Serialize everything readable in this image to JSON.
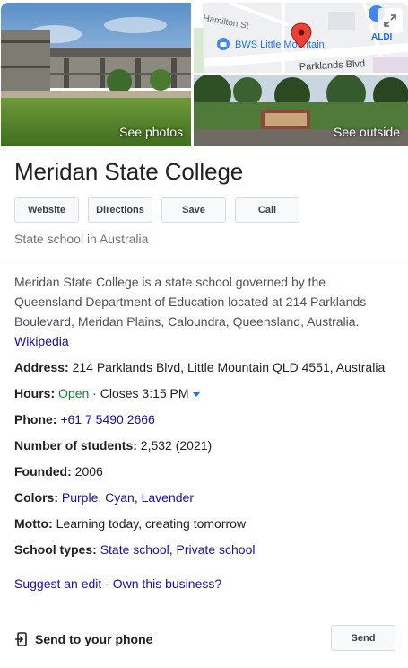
{
  "photos": {
    "left_label": "See photos",
    "right_label": "See outside",
    "map": {
      "street_top": "Hamilton St",
      "poi_label": "BWS Little Mountain",
      "street_main": "Parklands Blvd",
      "store_label": "ALDI"
    }
  },
  "title": "Meridan State College",
  "actions": {
    "website": "Website",
    "directions": "Directions",
    "save": "Save",
    "call": "Call"
  },
  "subtitle": "State school in Australia",
  "description": {
    "text": "Meridan State College is a state school governed by the Queensland Department of Education located at 214 Parklands Boulevard, Meridan Plains, Caloundra, Queensland, Australia.",
    "source": "Wikipedia"
  },
  "facts": {
    "address": {
      "label": "Address:",
      "value": "214 Parklands Blvd, Little Mountain QLD 4551, Australia"
    },
    "hours": {
      "label": "Hours:",
      "status": "Open",
      "sep": " · ",
      "closes": "Closes 3:15 PM"
    },
    "phone": {
      "label": "Phone:",
      "value": "+61 7 5490 2666"
    },
    "students": {
      "label": "Number of students:",
      "value": "2,532 (2021)"
    },
    "founded": {
      "label": "Founded:",
      "value": "2006"
    },
    "colors": {
      "label": "Colors:",
      "items": [
        "Purple",
        "Cyan",
        "Lavender"
      ],
      "sep": ", "
    },
    "motto": {
      "label": "Motto:",
      "value": "Learning today, creating tomorrow"
    },
    "school_types": {
      "label": "School types:",
      "items": [
        "State school",
        "Private school"
      ],
      "sep": ", "
    }
  },
  "footer": {
    "suggest_edit": "Suggest an edit",
    "dot": " · ",
    "own_business": "Own this business?",
    "send_to_phone": "Send to your phone",
    "send": "Send"
  },
  "colors": {
    "link": "#1a0dab",
    "open": "#188038",
    "map_pin": "#ea4335",
    "poi": "#1a73e8"
  },
  "icons": {
    "expand": "expand-icon",
    "pin": "map-pin-icon",
    "send": "send-to-phone-icon"
  }
}
